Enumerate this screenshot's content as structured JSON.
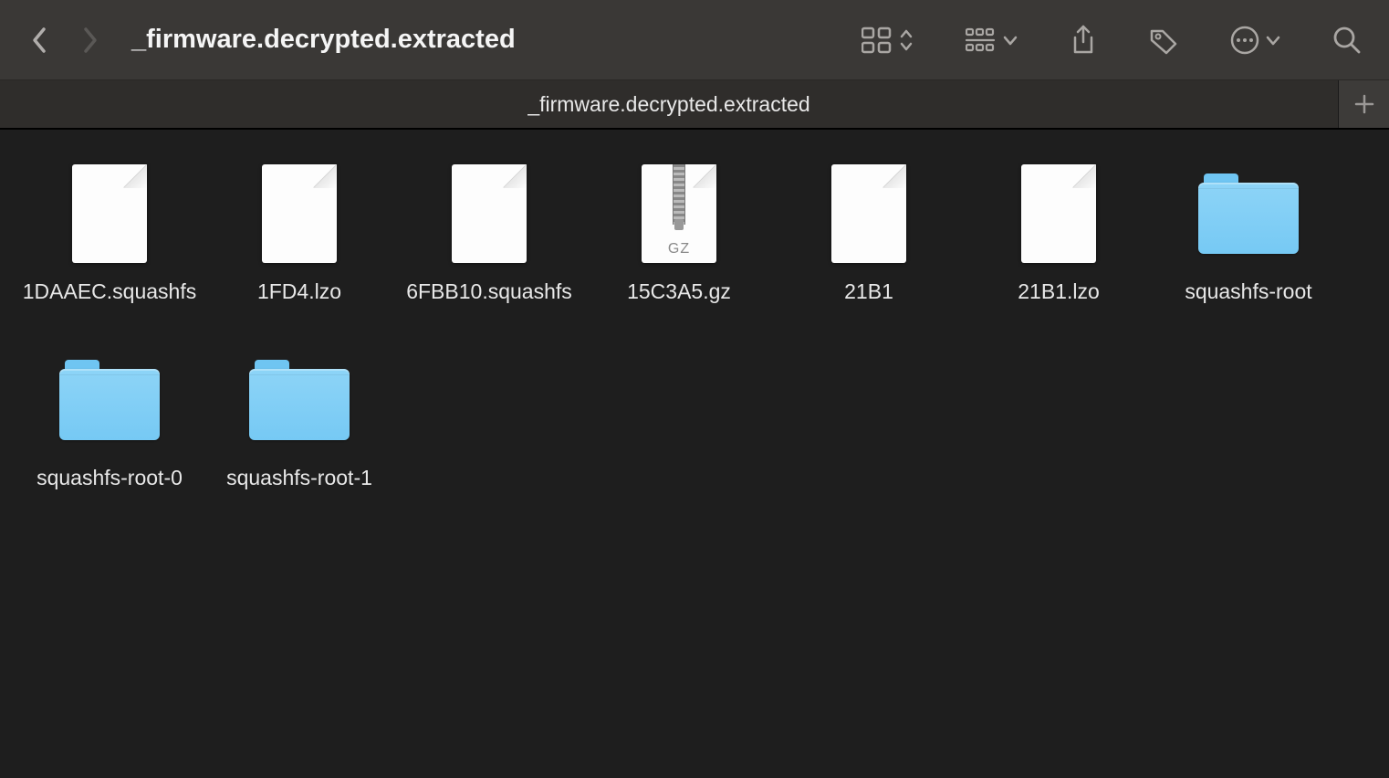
{
  "window": {
    "title": "_firmware.decrypted.extracted"
  },
  "tab": {
    "label": "_firmware.decrypted.extracted"
  },
  "files": [
    {
      "name": "1DAAEC.squashfs",
      "type": "file"
    },
    {
      "name": "1FD4.lzo",
      "type": "file"
    },
    {
      "name": "6FBB10.squashfs",
      "type": "file"
    },
    {
      "name": "15C3A5.gz",
      "type": "gz",
      "badge": "GZ"
    },
    {
      "name": "21B1",
      "type": "file"
    },
    {
      "name": "21B1.lzo",
      "type": "file"
    },
    {
      "name": "squashfs-root",
      "type": "folder"
    },
    {
      "name": "squashfs-root-0",
      "type": "folder"
    },
    {
      "name": "squashfs-root-1",
      "type": "folder"
    }
  ]
}
